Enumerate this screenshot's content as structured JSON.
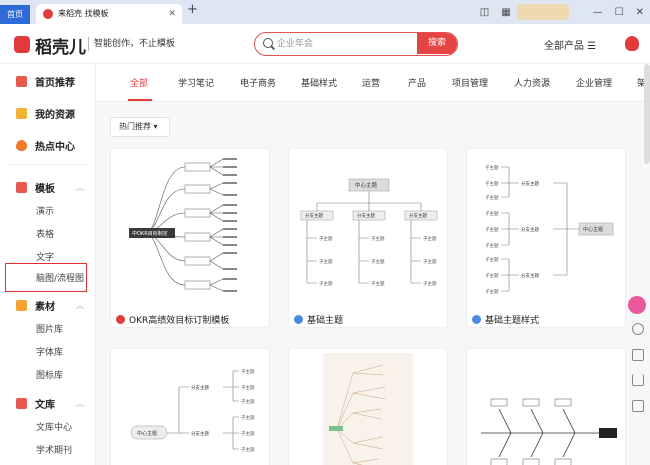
{
  "browser": {
    "home_tab": "首页",
    "active_tab": "来稻壳 找模板",
    "close_glyph": "✕",
    "new_tab_glyph": "+"
  },
  "header": {
    "logo_text": "稻壳儿",
    "slogan": "智能创作，不止模板",
    "search_placeholder": "企业年会",
    "search_button": "搜索",
    "all_products": "全部产品 ☰"
  },
  "sidebar": {
    "home": "首页推荐",
    "resources": "我的资源",
    "hot": "热点中心",
    "templates": "模板",
    "template_items": [
      "演示",
      "表格",
      "文字",
      "脑图/流程图"
    ],
    "materials": "素材",
    "material_items": [
      "图片库",
      "字体库",
      "图标库"
    ],
    "library": "文库",
    "library_items": [
      "文库中心",
      "学术期刊"
    ]
  },
  "categories": [
    "全部",
    "学习笔记",
    "电子商务",
    "基础样式",
    "运营",
    "产品",
    "项目管理",
    "人力资源",
    "企业管理",
    "架"
  ],
  "sort": "热门推荐",
  "sort_arrow": "▾",
  "cards": [
    {
      "title": "OKR高绩效目标订制模板",
      "icon_color": "#e23b3b"
    },
    {
      "title": "基础主题",
      "icon_color": "#4a8be0"
    },
    {
      "title": "基础主题样式",
      "icon_color": "#4a8be0"
    }
  ],
  "thumb2": {
    "center": "中心主题",
    "branch": "分支主题",
    "sub": "子主题"
  },
  "thumb1": {
    "center": "中OKR目标制定"
  },
  "colors": {
    "brand": "#e23b3b",
    "tab_blue": "#2f6bd6"
  }
}
